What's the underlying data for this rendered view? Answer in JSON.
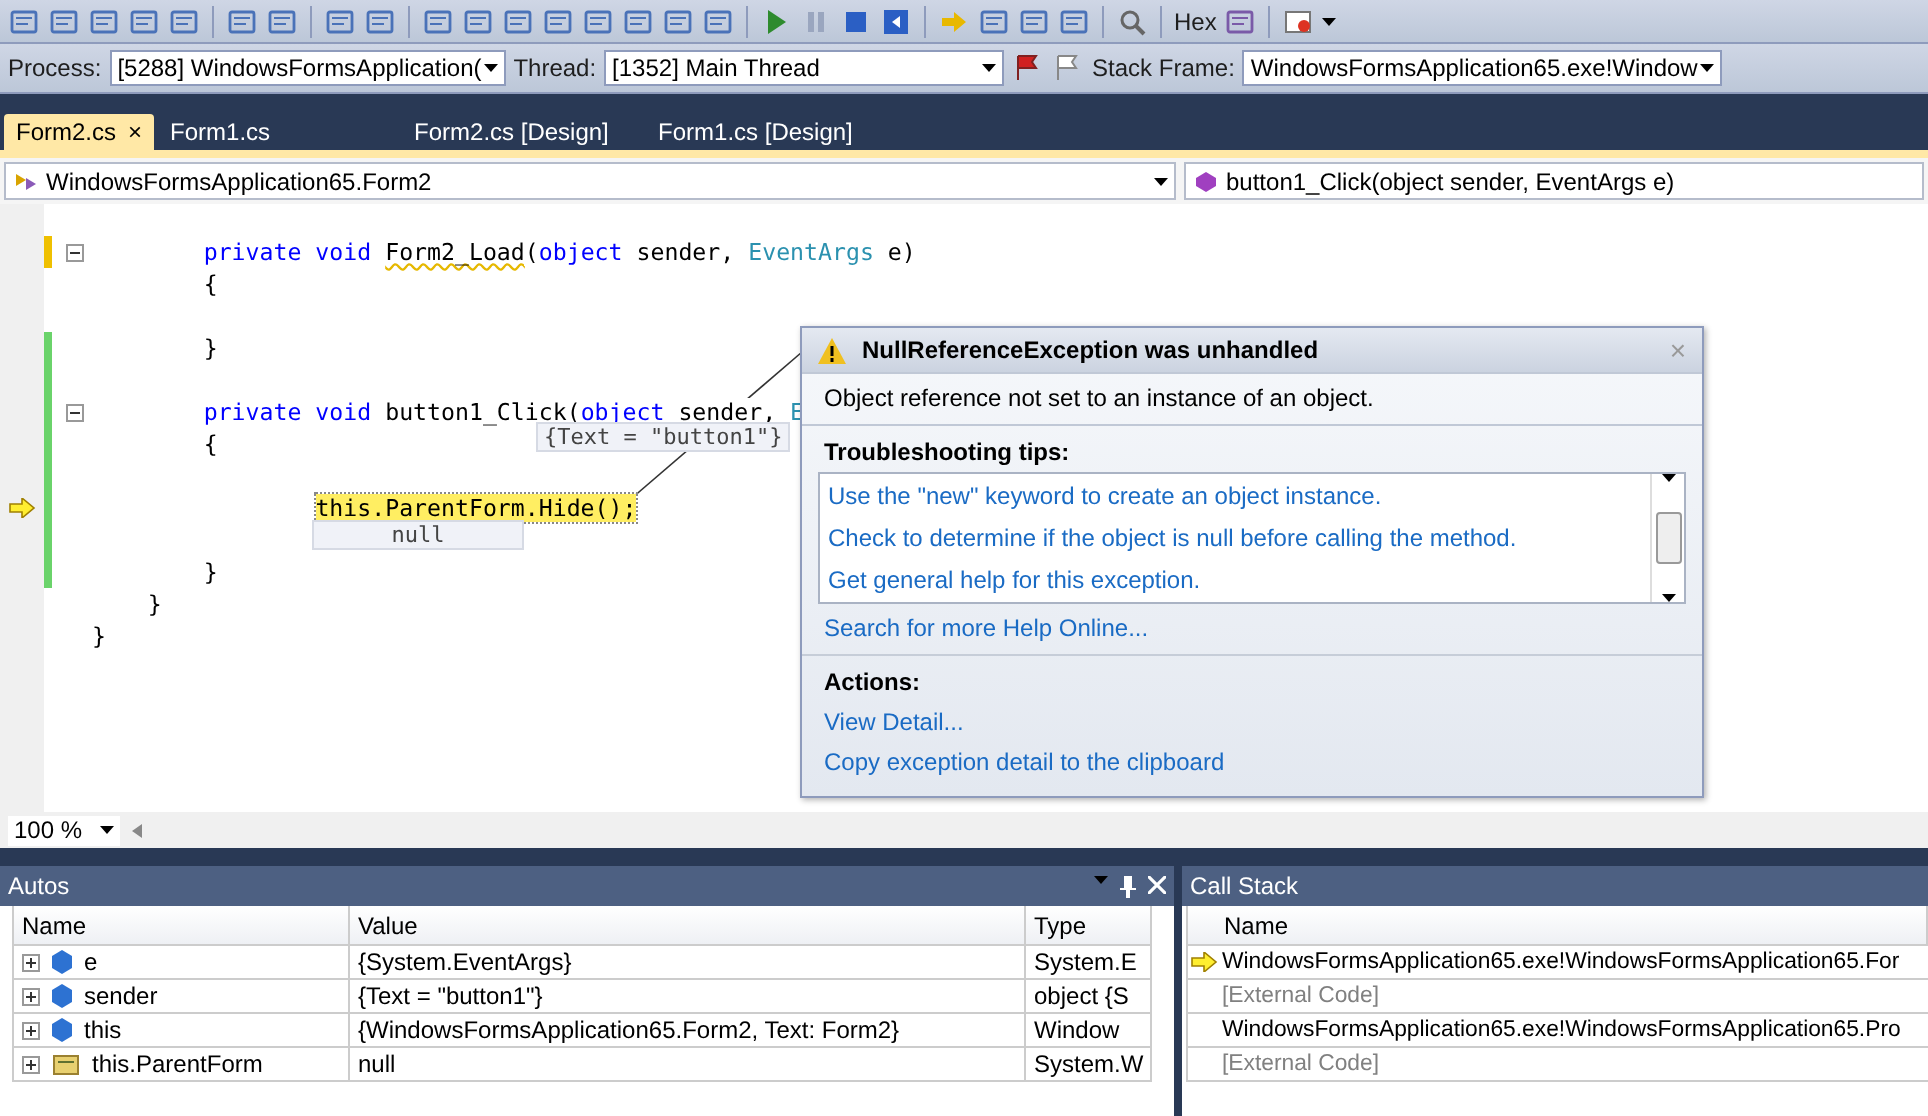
{
  "toolbar": {
    "hex_label": "Hex"
  },
  "debug_bar": {
    "process_label": "Process:",
    "process": "[5288] WindowsFormsApplication(",
    "thread_label": "Thread:",
    "thread": "[1352] Main Thread",
    "stack_frame_label": "Stack Frame:",
    "stack_frame": "WindowsFormsApplication65.exe!Window"
  },
  "tabs": [
    {
      "label": "Form2.cs",
      "selected": true,
      "close": "×"
    },
    {
      "label": "Form1.cs",
      "selected": false
    },
    {
      "label": "Form2.cs [Design]",
      "selected": false
    },
    {
      "label": "Form1.cs [Design]",
      "selected": false
    }
  ],
  "nav_bar": {
    "type": "WindowsFormsApplication65.Form2",
    "member": "button1_Click(object sender, EventArgs e)"
  },
  "code_lines": [
    {
      "changed": true,
      "saved": false,
      "collapsible": true,
      "current": false,
      "tokens": [
        {
          "text": "        private void ",
          "kind": "keyword"
        },
        {
          "text": "Form2_Load",
          "kind": "squiggle"
        },
        {
          "text": "(",
          "kind": "plain"
        },
        {
          "text": "object",
          "kind": "keyword"
        },
        {
          "text": " sender, ",
          "kind": "plain"
        },
        {
          "text": "EventArgs",
          "kind": "type"
        },
        {
          "text": " e)",
          "kind": "plain"
        }
      ]
    },
    {
      "changed": false,
      "collapsible": false,
      "current": false,
      "tokens": [
        {
          "text": "        {",
          "kind": "plain"
        }
      ]
    },
    {
      "changed": false,
      "collapsible": false,
      "current": false
    },
    {
      "changed": true,
      "saved": true,
      "collapsible": false,
      "current": false,
      "tokens": [
        {
          "text": "        }",
          "kind": "plain"
        }
      ]
    },
    {
      "changed": true,
      "saved": true,
      "collapsible": false,
      "current": false
    },
    {
      "changed": true,
      "saved": true,
      "collapsible": true,
      "current": false,
      "tokens": [
        {
          "text": "        private void ",
          "kind": "keyword"
        },
        {
          "text": "button1_Click(",
          "kind": "plain"
        },
        {
          "text": "object",
          "kind": "keyword"
        },
        {
          "text": " sender, ",
          "kind": "plain"
        },
        {
          "text": "E",
          "kind": "type"
        }
      ],
      "data_tip": "{Text = \"button1\"}"
    },
    {
      "changed": true,
      "saved": true,
      "collapsible": false,
      "current": false,
      "tokens": [
        {
          "text": "        {",
          "kind": "plain"
        }
      ]
    },
    {
      "changed": true,
      "saved": true,
      "collapsible": false,
      "current": false
    },
    {
      "changed": true,
      "saved": true,
      "collapsible": false,
      "current": true,
      "tokens": [
        {
          "text": "                this.ParentForm.Hide();",
          "kind": "statement"
        }
      ],
      "data_tip": "null"
    },
    {
      "changed": true,
      "saved": true,
      "collapsible": false,
      "current": false
    },
    {
      "changed": true,
      "saved": true,
      "collapsible": false,
      "current": false,
      "tokens": [
        {
          "text": "        }",
          "kind": "plain"
        }
      ]
    },
    {
      "changed": false,
      "collapsible": false,
      "current": false,
      "tokens": [
        {
          "text": "    }",
          "kind": "plain"
        }
      ]
    },
    {
      "changed": false,
      "collapsible": false,
      "current": false,
      "tokens": [
        {
          "text": "}",
          "kind": "plain"
        }
      ]
    }
  ],
  "exception": {
    "title": "NullReferenceException was unhandled",
    "close": "×",
    "message": "Object reference not set to an instance of an object.",
    "tips_heading": "Troubleshooting tips:",
    "tips": [
      "Use the \"new\" keyword to create an object instance.",
      "Check to determine if the object is null before calling the method.",
      "Get general help for this exception."
    ],
    "search_link": "Search for more Help Online...",
    "actions_heading": "Actions:",
    "actions": [
      "View Detail...",
      "Copy exception detail to the clipboard"
    ]
  },
  "zoom": "100 %",
  "autos": {
    "title": "Autos",
    "columns": [
      "Name",
      "Value",
      "Type"
    ],
    "rows": [
      {
        "kind": "field",
        "name": "e",
        "value": "{System.EventArgs}",
        "type": "System.E"
      },
      {
        "kind": "field",
        "name": "sender",
        "value": "{Text = \"button1\"}",
        "type": "object {S"
      },
      {
        "kind": "field",
        "name": "this",
        "value": "{WindowsFormsApplication65.Form2, Text: Form2}",
        "type": "Window"
      },
      {
        "kind": "property",
        "name": "this.ParentForm",
        "value": "null",
        "type": "System.W"
      }
    ]
  },
  "call_stack": {
    "title": "Call Stack",
    "columns": [
      "Name"
    ],
    "rows": [
      {
        "kind": "frame",
        "current": true,
        "name": "WindowsFormsApplication65.exe!WindowsFormsApplication65.For"
      },
      {
        "kind": "external",
        "current": false,
        "name": "[External Code]"
      },
      {
        "kind": "frame",
        "current": false,
        "name": "WindowsFormsApplication65.exe!WindowsFormsApplication65.Pro"
      },
      {
        "kind": "external",
        "current": false,
        "name": "[External Code]"
      }
    ]
  }
}
